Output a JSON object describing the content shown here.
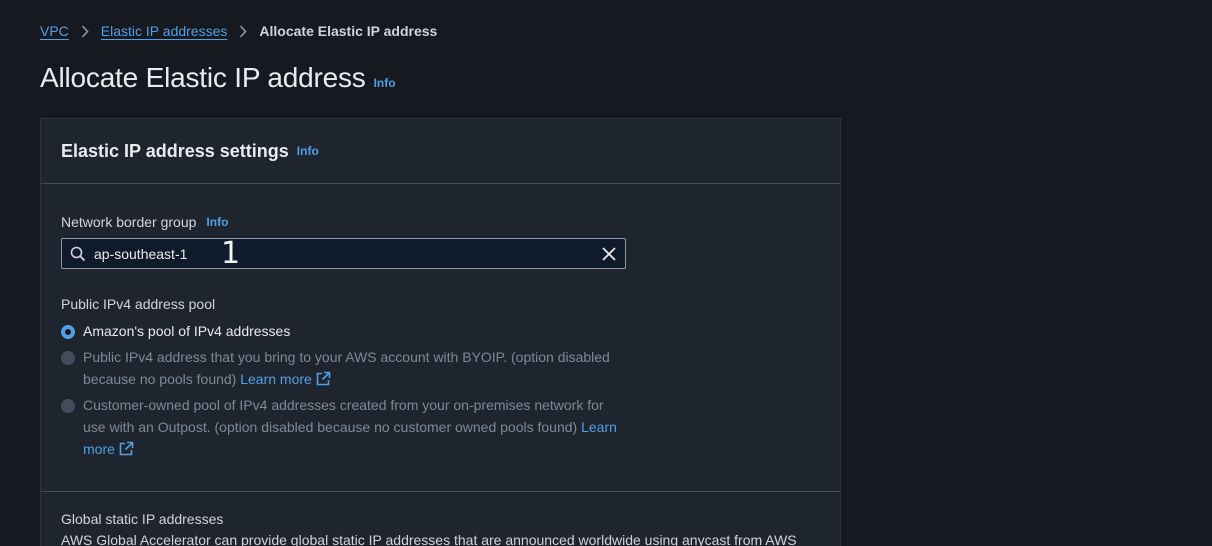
{
  "breadcrumb": {
    "items": [
      "VPC",
      "Elastic IP addresses"
    ],
    "current": "Allocate Elastic IP address"
  },
  "page": {
    "title": "Allocate Elastic IP address",
    "info": "Info"
  },
  "settings": {
    "title": "Elastic IP address settings",
    "info": "Info",
    "network_border_group": {
      "label": "Network border group",
      "info": "Info",
      "value": "ap-southeast-1",
      "marker": "1"
    },
    "ipv4_pool": {
      "label": "Public IPv4 address pool",
      "options": [
        {
          "label": "Amazon's pool of IPv4 addresses",
          "selected": true,
          "disabled": false
        },
        {
          "label": "Public IPv4 address that you bring to your AWS account with BYOIP. (option disabled because no pools found)",
          "link": "Learn more",
          "selected": false,
          "disabled": true
        },
        {
          "label": "Customer-owned pool of IPv4 addresses created from your on-premises network for use with an Outpost. (option disabled because no customer owned pools found)",
          "link": "Learn more",
          "selected": false,
          "disabled": true
        }
      ]
    },
    "global_static": {
      "title": "Global static IP addresses",
      "description": "AWS Global Accelerator can provide global static IP addresses that are announced worldwide using anycast from AWS"
    }
  },
  "colors": {
    "background": "#16191f",
    "panel": "#1f252e",
    "link": "#539fe5",
    "text": "#d1d5db",
    "disabled_text": "#7d8998"
  },
  "icons": {
    "breadcrumb_separator": "chevron-right-icon",
    "search": "search-icon",
    "clear": "close-icon",
    "external": "external-link-icon"
  }
}
